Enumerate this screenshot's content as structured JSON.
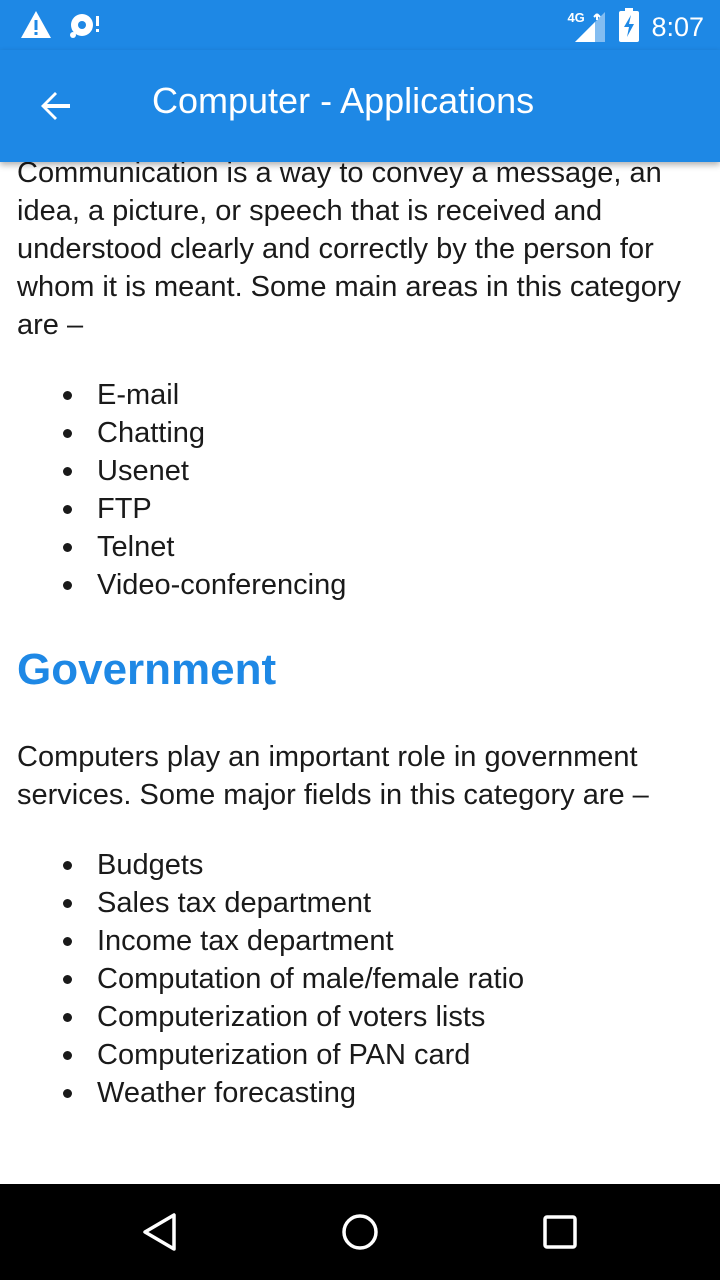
{
  "status_bar": {
    "time": "8:07",
    "network": "4G",
    "left_icons": [
      "warning-icon",
      "notification-icon"
    ],
    "right_icons": [
      "signal-icon",
      "battery-charging-icon"
    ]
  },
  "app_bar": {
    "title": "Computer - Applications",
    "back_icon": "arrow-back-icon",
    "color": "#1e88e5"
  },
  "content": {
    "intro_paragraph": "Communication is a way to convey a message, an idea, a picture, or speech that is received and understood clearly and correctly by the person for whom it is meant. Some main areas in this category are –",
    "communication_items": [
      "E-mail",
      "Chatting",
      "Usenet",
      "FTP",
      "Telnet",
      "Video-conferencing"
    ],
    "government_heading": "Government",
    "government_paragraph": "Computers play an important role in government services. Some major fields in this category are –",
    "government_items": [
      "Budgets",
      "Sales tax department",
      "Income tax department",
      "Computation of male/female ratio",
      "Computerization of voters lists",
      "Computerization of PAN card",
      "Weather forecasting"
    ]
  },
  "nav_bar": {
    "buttons": [
      "back-triangle-icon",
      "home-circle-icon",
      "recents-square-icon"
    ]
  }
}
